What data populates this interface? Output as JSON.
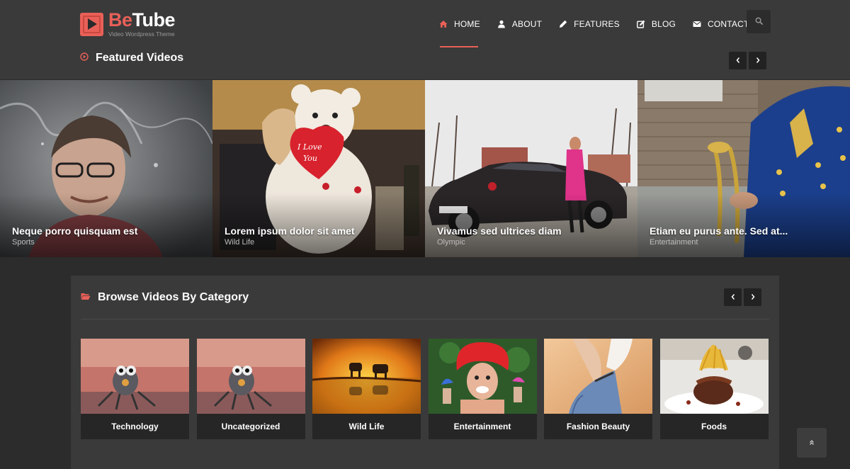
{
  "brand": {
    "name_part1": "Be",
    "name_part2": "Tube",
    "tagline": "Video Wordpress Theme",
    "accent": "#e96058"
  },
  "nav": {
    "items": [
      {
        "label": "HOME",
        "icon": "home-icon",
        "active": true
      },
      {
        "label": "ABOUT",
        "icon": "user-icon",
        "active": false
      },
      {
        "label": "FEATURES",
        "icon": "pencil-icon",
        "active": false
      },
      {
        "label": "BLOG",
        "icon": "edit-icon",
        "active": false
      },
      {
        "label": "CONTACT",
        "icon": "envelope-icon",
        "active": false
      }
    ],
    "search_icon": "search-icon"
  },
  "featured": {
    "title": "Featured Videos",
    "icon": "play-circle-icon",
    "items": [
      {
        "title": "Neque porro quisquam est",
        "category": "Sports"
      },
      {
        "title": "Lorem ipsum dolor sit amet",
        "category": "Wild Life"
      },
      {
        "title": "Vivamus sed ultrices diam",
        "category": "Olympic"
      },
      {
        "title": "Etiam eu purus ante. Sed at...",
        "category": "Entertainment"
      }
    ]
  },
  "browse": {
    "title": "Browse Videos By Category",
    "icon": "folder-open-icon",
    "categories": [
      {
        "label": "Technology"
      },
      {
        "label": "Uncategorized"
      },
      {
        "label": "Wild Life"
      },
      {
        "label": "Entertainment"
      },
      {
        "label": "Fashion Beauty"
      },
      {
        "label": "Foods"
      }
    ]
  },
  "scroll_top_icon": "double-chevron-up-icon"
}
